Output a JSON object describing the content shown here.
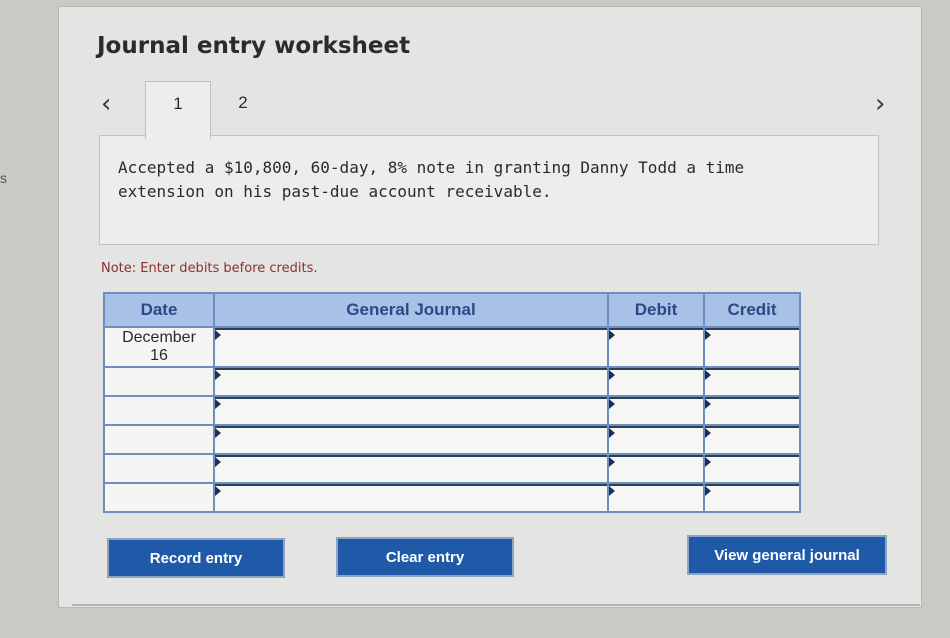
{
  "edge_glyph": "s",
  "title": "Journal entry worksheet",
  "nav": {
    "prev_icon": "chevron-left-icon",
    "next_icon": "chevron-right-icon"
  },
  "tabs": [
    {
      "label": "1",
      "active": true
    },
    {
      "label": "2",
      "active": false
    }
  ],
  "description": "Accepted a $10,800, 60-day, 8% note in granting Danny Todd a time extension on his past-due account receivable.",
  "note": "Note: Enter debits before credits.",
  "table": {
    "headers": {
      "date": "Date",
      "account": "General Journal",
      "debit": "Debit",
      "credit": "Credit"
    },
    "rows": [
      {
        "date_month": "December",
        "date_day": "16",
        "account": "",
        "debit": "",
        "credit": ""
      },
      {
        "date_month": "",
        "date_day": "",
        "account": "",
        "debit": "",
        "credit": ""
      },
      {
        "date_month": "",
        "date_day": "",
        "account": "",
        "debit": "",
        "credit": ""
      },
      {
        "date_month": "",
        "date_day": "",
        "account": "",
        "debit": "",
        "credit": ""
      },
      {
        "date_month": "",
        "date_day": "",
        "account": "",
        "debit": "",
        "credit": ""
      },
      {
        "date_month": "",
        "date_day": "",
        "account": "",
        "debit": "",
        "credit": ""
      }
    ]
  },
  "buttons": {
    "record": "Record entry",
    "clear": "Clear entry",
    "view": "View general journal"
  },
  "colors": {
    "button_blue": "#1f5aa8",
    "header_blue": "#a9c1e6",
    "border_blue": "#6d8fbf",
    "note_red": "#8a3030"
  }
}
